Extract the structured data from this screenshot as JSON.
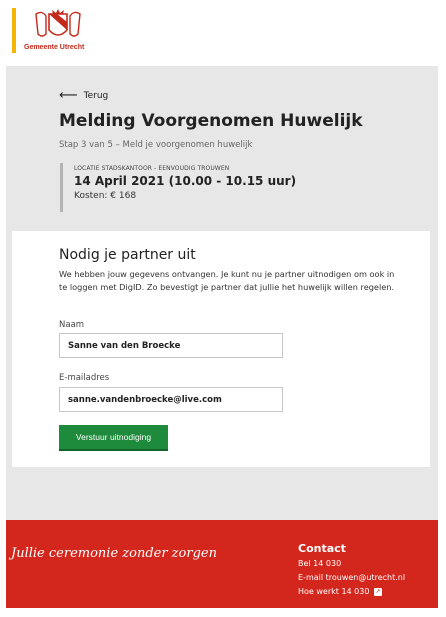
{
  "header": {
    "logo_text": "Gemeente Utrecht",
    "accent_color": "#f5b400",
    "brand_color": "#c42a1c"
  },
  "page": {
    "back_label": "Terug",
    "title": "Melding Voorgenomen Huwelijk",
    "step": "Stap 3 van 5 – Meld je voorgenomen huwelijk"
  },
  "location": {
    "label": "LOCATIE STADSKANTOOR - EENVOUDIG TROUWEN",
    "date": "14 April 2021 (10.00 - 10.15 uur)",
    "cost": "Kosten: € 168"
  },
  "form": {
    "heading": "Nodig je partner uit",
    "intro": "We hebben jouw gegevens ontvangen. Je kunt nu je partner uitnodigen om ook in te loggen met DigID. Zo bevestigt je partner dat jullie het huwelijk willen regelen.",
    "name_label": "Naam",
    "name_value": "Sanne van den Broecke",
    "email_label": "E-mailadres",
    "email_value": "sanne.vandenbroecke@live.com",
    "submit_label": "Verstuur uitnodiging",
    "button_color": "#1e8a3b"
  },
  "footer": {
    "slogan": "Jullie ceremonie zonder zorgen",
    "contact_heading": "Contact",
    "phone": "Bel 14 030",
    "email": "E-mail trouwen@utrecht.nl",
    "how_link": "Hoe werkt 14 030",
    "background_color": "#d3261c"
  }
}
